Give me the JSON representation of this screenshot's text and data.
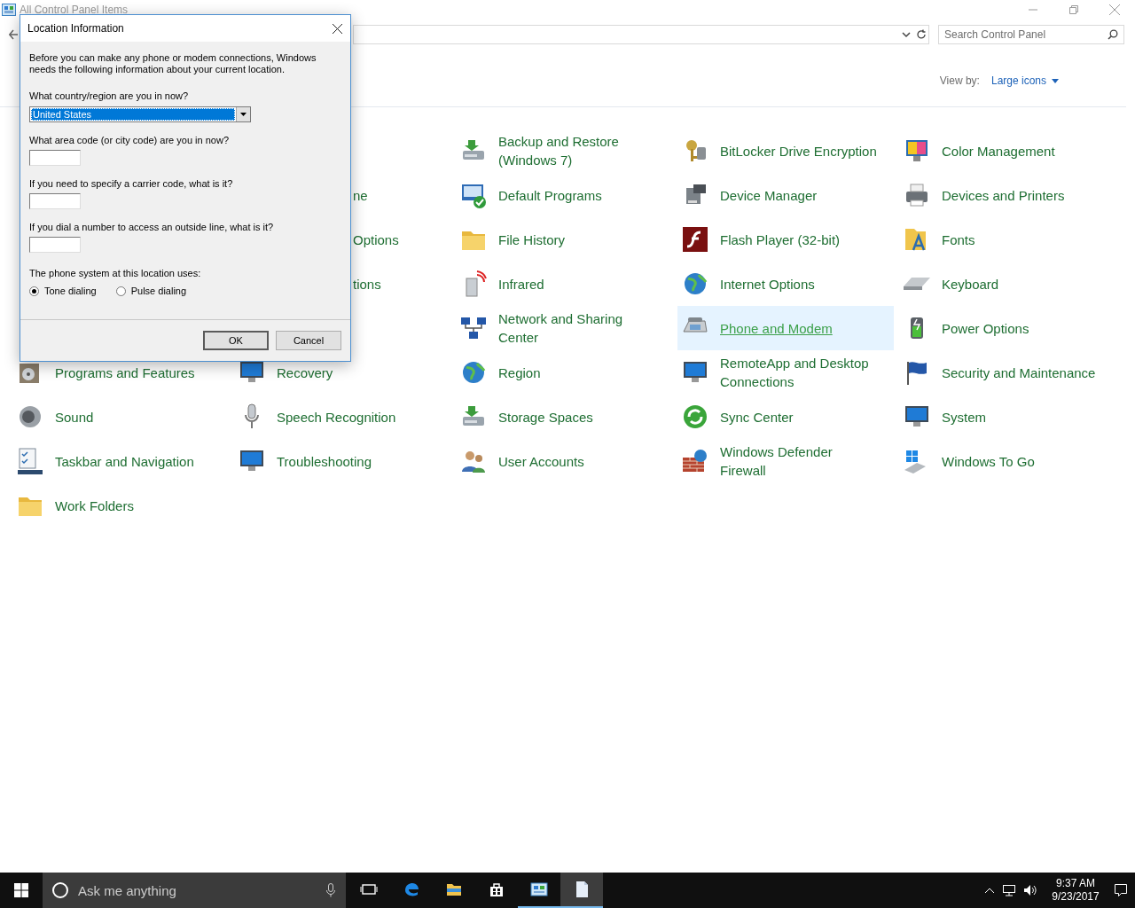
{
  "window": {
    "title": "All Control Panel Items",
    "search": {
      "placeholder": "Search Control Panel"
    },
    "view_by": {
      "label": "View by:",
      "value": "Large icons"
    }
  },
  "items": [
    {
      "kind": "covered"
    },
    {
      "kind": "covered"
    },
    {
      "kind": "applet",
      "label": "Backup and Restore (Windows 7)",
      "selected": false
    },
    {
      "kind": "applet",
      "label": "BitLocker Drive Encryption",
      "selected": false
    },
    {
      "kind": "applet",
      "label": "Color Management",
      "selected": false
    },
    {
      "kind": "covered"
    },
    {
      "kind": "clipped",
      "label": "ne"
    },
    {
      "kind": "applet",
      "label": "Default Programs",
      "selected": false
    },
    {
      "kind": "applet",
      "label": "Device Manager",
      "selected": false
    },
    {
      "kind": "applet",
      "label": "Devices and Printers",
      "selected": false
    },
    {
      "kind": "covered"
    },
    {
      "kind": "clipped",
      "label": "Options"
    },
    {
      "kind": "applet",
      "label": "File History",
      "selected": false
    },
    {
      "kind": "applet",
      "label": "Flash Player (32-bit)",
      "selected": false
    },
    {
      "kind": "applet",
      "label": "Fonts",
      "selected": false
    },
    {
      "kind": "covered"
    },
    {
      "kind": "clipped",
      "label": "tions"
    },
    {
      "kind": "applet",
      "label": "Infrared",
      "selected": false
    },
    {
      "kind": "applet",
      "label": "Internet Options",
      "selected": false
    },
    {
      "kind": "applet",
      "label": "Keyboard",
      "selected": false
    },
    {
      "kind": "covered"
    },
    {
      "kind": "covered"
    },
    {
      "kind": "applet",
      "label": "Network and Sharing Center",
      "selected": false
    },
    {
      "kind": "applet",
      "label": "Phone and Modem",
      "selected": true
    },
    {
      "kind": "applet",
      "label": "Power Options",
      "selected": false
    },
    {
      "kind": "applet",
      "label": "Programs and Features",
      "selected": false
    },
    {
      "kind": "applet",
      "label": "Recovery",
      "selected": false
    },
    {
      "kind": "applet",
      "label": "Region",
      "selected": false
    },
    {
      "kind": "applet",
      "label": "RemoteApp and Desktop Connections",
      "selected": false
    },
    {
      "kind": "applet",
      "label": "Security and Maintenance",
      "selected": false
    },
    {
      "kind": "applet",
      "label": "Sound",
      "selected": false
    },
    {
      "kind": "applet",
      "label": "Speech Recognition",
      "selected": false
    },
    {
      "kind": "applet",
      "label": "Storage Spaces",
      "selected": false
    },
    {
      "kind": "applet",
      "label": "Sync Center",
      "selected": false
    },
    {
      "kind": "applet",
      "label": "System",
      "selected": false
    },
    {
      "kind": "applet",
      "label": "Taskbar and Navigation",
      "selected": false
    },
    {
      "kind": "applet",
      "label": "Troubleshooting",
      "selected": false
    },
    {
      "kind": "applet",
      "label": "User Accounts",
      "selected": false
    },
    {
      "kind": "applet",
      "label": "Windows Defender Firewall",
      "selected": false
    },
    {
      "kind": "applet",
      "label": "Windows To Go",
      "selected": false
    },
    {
      "kind": "applet",
      "label": "Work Folders",
      "selected": false
    }
  ],
  "dialog": {
    "title": "Location Information",
    "intro": "Before you can make any phone or modem connections, Windows needs the following information about your current location.",
    "country": {
      "label": "What country/region are you in now?",
      "value": "United States"
    },
    "fields": [
      {
        "label": "What area code (or city code) are you in now?"
      },
      {
        "label": "If you need to specify a carrier code, what is it?"
      },
      {
        "label": "If you dial a number to access an outside line, what is it?"
      }
    ],
    "dialing": {
      "label": "The phone system at this location uses:",
      "options": [
        {
          "label": "Tone dialing",
          "selected": true
        },
        {
          "label": "Pulse dialing",
          "selected": false
        }
      ]
    },
    "buttons": [
      {
        "label": "OK",
        "default": true
      },
      {
        "label": "Cancel",
        "default": false
      }
    ]
  },
  "taskbar": {
    "search": {
      "placeholder": "Ask me anything"
    },
    "apps": [
      {
        "kind": "task-view",
        "running": false,
        "selected": false
      },
      {
        "kind": "edge",
        "running": false,
        "selected": false
      },
      {
        "kind": "explorer",
        "running": false,
        "selected": false
      },
      {
        "kind": "store",
        "running": false,
        "selected": false
      },
      {
        "kind": "control-panel",
        "running": true,
        "selected": false
      },
      {
        "kind": "document",
        "running": true,
        "selected": true
      }
    ],
    "time": "9:37 AM",
    "date": "9/23/2017"
  }
}
